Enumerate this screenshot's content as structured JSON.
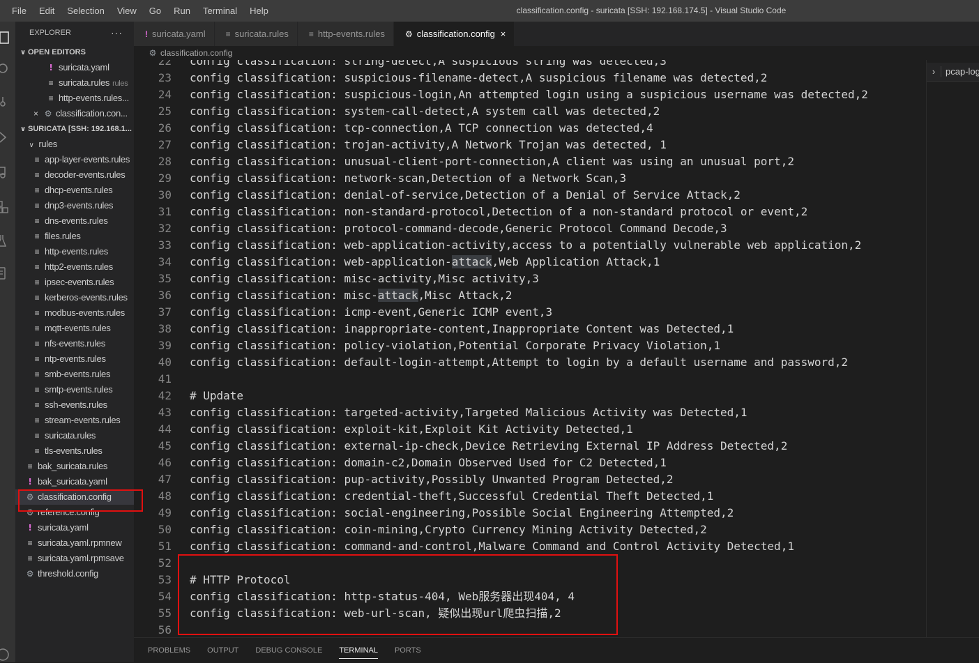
{
  "menu": [
    "File",
    "Edit",
    "Selection",
    "View",
    "Go",
    "Run",
    "Terminal",
    "Help"
  ],
  "window_title": "classification.config - suricata [SSH: 192.168.174.5] - Visual Studio Code",
  "explorer": {
    "title": "EXPLORER",
    "more": "···",
    "open_editors_header": "OPEN EDITORS",
    "open_editors": [
      {
        "name": "suricata.yaml",
        "icon": "yaml",
        "desc": ""
      },
      {
        "name": "suricata.rules",
        "icon": "rules",
        "desc": "rules"
      },
      {
        "name": "http-events.rules...",
        "icon": "rules",
        "desc": ""
      },
      {
        "name": "classification.con...",
        "icon": "config",
        "desc": "",
        "close": "×"
      }
    ],
    "workspace_header": "SURICATA [SSH: 192.168.1...",
    "rules_folder": "rules",
    "rules_files": [
      "app-layer-events.rules",
      "decoder-events.rules",
      "dhcp-events.rules",
      "dnp3-events.rules",
      "dns-events.rules",
      "files.rules",
      "http-events.rules",
      "http2-events.rules",
      "ipsec-events.rules",
      "kerberos-events.rules",
      "modbus-events.rules",
      "mqtt-events.rules",
      "nfs-events.rules",
      "ntp-events.rules",
      "smb-events.rules",
      "smtp-events.rules",
      "ssh-events.rules",
      "stream-events.rules",
      "suricata.rules",
      "tls-events.rules"
    ],
    "root_files": [
      {
        "name": "bak_suricata.rules",
        "icon": "rules"
      },
      {
        "name": "bak_suricata.yaml",
        "icon": "yaml"
      },
      {
        "name": "classification.config",
        "icon": "config",
        "selected": true
      },
      {
        "name": "reference.config",
        "icon": "config"
      },
      {
        "name": "suricata.yaml",
        "icon": "yaml"
      },
      {
        "name": "suricata.yaml.rpmnew",
        "icon": "rules"
      },
      {
        "name": "suricata.yaml.rpmsave",
        "icon": "rules"
      },
      {
        "name": "threshold.config",
        "icon": "config"
      }
    ]
  },
  "tabs": [
    {
      "label": "suricata.yaml",
      "icon": "yaml"
    },
    {
      "label": "suricata.rules",
      "icon": "rules"
    },
    {
      "label": "http-events.rules",
      "icon": "rules"
    },
    {
      "label": "classification.config",
      "icon": "config",
      "active": true,
      "close": "×"
    }
  ],
  "breadcrumb": "classification.config",
  "code": [
    {
      "n": "22",
      "t": "config classification: string-detect,A suspicious string was detected,3"
    },
    {
      "n": "23",
      "t": "config classification: suspicious-filename-detect,A suspicious filename was detected,2"
    },
    {
      "n": "24",
      "t": "config classification: suspicious-login,An attempted login using a suspicious username was detected,2"
    },
    {
      "n": "25",
      "t": "config classification: system-call-detect,A system call was detected,2"
    },
    {
      "n": "26",
      "t": "config classification: tcp-connection,A TCP connection was detected,4"
    },
    {
      "n": "27",
      "t": "config classification: trojan-activity,A Network Trojan was detected, 1"
    },
    {
      "n": "28",
      "t": "config classification: unusual-client-port-connection,A client was using an unusual port,2"
    },
    {
      "n": "29",
      "t": "config classification: network-scan,Detection of a Network Scan,3"
    },
    {
      "n": "30",
      "t": "config classification: denial-of-service,Detection of a Denial of Service Attack,2"
    },
    {
      "n": "31",
      "t": "config classification: non-standard-protocol,Detection of a non-standard protocol or event,2"
    },
    {
      "n": "32",
      "t": "config classification: protocol-command-decode,Generic Protocol Command Decode,3"
    },
    {
      "n": "33",
      "t": "config classification: web-application-activity,access to a potentially vulnerable web application,2"
    },
    {
      "n": "34",
      "t": "config classification: web-application-",
      "h": "attack",
      "a": ",Web Application Attack,1"
    },
    {
      "n": "35",
      "t": "config classification: misc-activity,Misc activity,3"
    },
    {
      "n": "36",
      "t": "config classification: misc-",
      "h": "attack",
      "a": ",Misc Attack,2"
    },
    {
      "n": "37",
      "t": "config classification: icmp-event,Generic ICMP event,3"
    },
    {
      "n": "38",
      "t": "config classification: inappropriate-content,Inappropriate Content was Detected,1"
    },
    {
      "n": "39",
      "t": "config classification: policy-violation,Potential Corporate Privacy Violation,1"
    },
    {
      "n": "40",
      "t": "config classification: default-login-attempt,Attempt to login by a default username and password,2"
    },
    {
      "n": "41",
      "t": ""
    },
    {
      "n": "42",
      "t": "# Update"
    },
    {
      "n": "43",
      "t": "config classification: targeted-activity,Targeted Malicious Activity was Detected,1"
    },
    {
      "n": "44",
      "t": "config classification: exploit-kit,Exploit Kit Activity Detected,1"
    },
    {
      "n": "45",
      "t": "config classification: external-ip-check,Device Retrieving External IP Address Detected,2"
    },
    {
      "n": "46",
      "t": "config classification: domain-c2,Domain Observed Used for C2 Detected,1"
    },
    {
      "n": "47",
      "t": "config classification: pup-activity,Possibly Unwanted Program Detected,2"
    },
    {
      "n": "48",
      "t": "config classification: credential-theft,Successful Credential Theft Detected,1"
    },
    {
      "n": "49",
      "t": "config classification: social-engineering,Possible Social Engineering Attempted,2"
    },
    {
      "n": "50",
      "t": "config classification: coin-mining,Crypto Currency Mining Activity Detected,2"
    },
    {
      "n": "51",
      "t": "config classification: command-and-control,Malware Command and Control Activity Detected,1"
    },
    {
      "n": "52",
      "t": ""
    },
    {
      "n": "53",
      "t": "# HTTP Protocol"
    },
    {
      "n": "54",
      "t": "config classification: http-status-404, Web服务器出现404, 4"
    },
    {
      "n": "55",
      "t": "config classification: web-url-scan, 疑似出现url爬虫扫描,2"
    },
    {
      "n": "56",
      "t": ""
    }
  ],
  "right_panel": {
    "label": "pcap-log",
    "chevron": "›"
  },
  "panel_tabs": [
    "PROBLEMS",
    "OUTPUT",
    "DEBUG CONSOLE",
    "TERMINAL",
    "PORTS"
  ],
  "active_panel_tab": "TERMINAL",
  "colors": {
    "accent_red": "#e01010",
    "editor_bg": "#1e1e1e",
    "sidebar_bg": "#252526"
  }
}
